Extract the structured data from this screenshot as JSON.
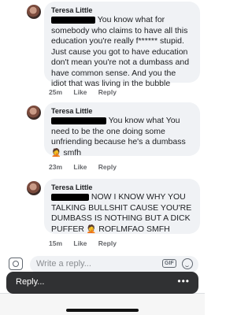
{
  "comments": [
    {
      "author": "Teresa Little",
      "first_line": "You know what for",
      "body": "somebody who claims to have all this education you're really f****** stupid. Just cause you got to have education don't mean you're not a dumbass and have common sense. And you the idiot that was living in the bubble",
      "time": "25m",
      "like": "Like",
      "reply": "Reply"
    },
    {
      "author": "Teresa Little",
      "first_line": "You know what You",
      "body": "need to be the one doing some unfriending because he's a dumbass",
      "emoji_text": "smfh",
      "time": "23m",
      "like": "Like",
      "reply": "Reply"
    },
    {
      "author": "Teresa Little",
      "first_line": "NOW I KNOW WHY YOU",
      "body": "TALKING BULLSHIT CAUSE YOU'RE DUMBASS IS NOTHING BUT A DICK PUFFER",
      "emoji_text": "ROFLMFAO SMFH",
      "time": "15m",
      "like": "Like",
      "reply": "Reply"
    }
  ],
  "input": {
    "placeholder": "Write a reply...",
    "gif_label": "GIF"
  },
  "toast": {
    "label": "Reply...",
    "more": "•••"
  },
  "icons": {
    "camera": "camera-icon",
    "gif": "gif-icon",
    "emoji": "smiley-icon",
    "more": "more-icon"
  }
}
